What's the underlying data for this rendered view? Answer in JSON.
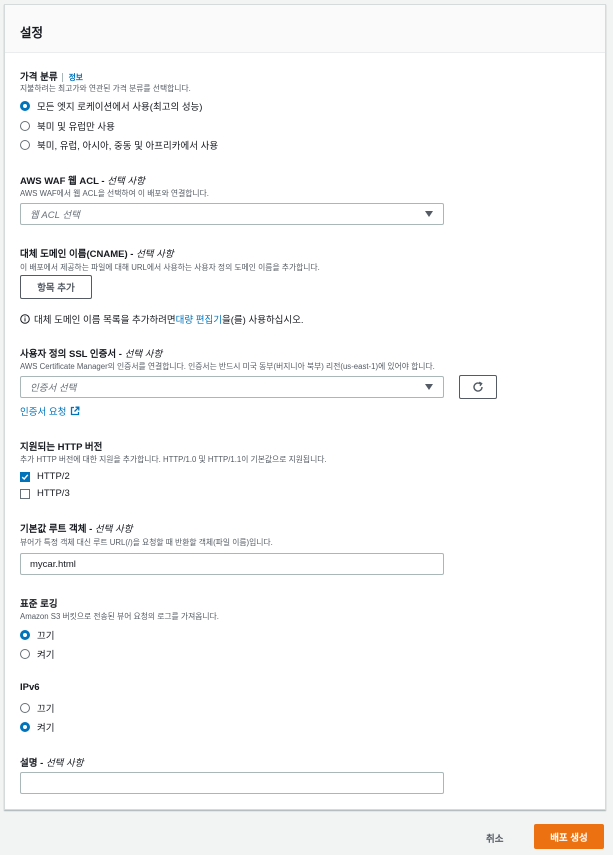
{
  "panel": {
    "title": "설정"
  },
  "price_class": {
    "label": "가격 분류",
    "info": "정보",
    "description": "지불하려는 최고가와 연관된 가격 분류를 선택합니다.",
    "options": [
      {
        "label": "모든 엣지 로케이션에서 사용(최고의 성능)",
        "selected": true
      },
      {
        "label": "북미 및 유럽만 사용",
        "selected": false
      },
      {
        "label": "북미, 유럽, 아시아, 중동 및 아프리카에서 사용",
        "selected": false
      }
    ]
  },
  "waf": {
    "label": "AWS WAF 웹 ACL - ",
    "optional": "선택 사항",
    "description": "AWS WAF에서 웹 ACL을 선택하여 이 배포와 연결합니다.",
    "placeholder": "웹 ACL 선택"
  },
  "cname": {
    "label": "대체 도메인 이름(CNAME) - ",
    "optional": "선택 사항",
    "description": "이 배포에서 제공하는 파일에 대해 URL에서 사용하는 사용자 정의 도메인 이름을 추가합니다.",
    "add_button": "항목 추가",
    "hint_before": "대체 도메인 이름 목록을 추가하려면 ",
    "hint_link": "대량 편집기",
    "hint_after": "을(를) 사용하십시오."
  },
  "ssl": {
    "label": "사용자 정의 SSL 인증서 - ",
    "optional": "선택 사항",
    "description": "AWS Certificate Manager의 인증서를 연결합니다. 인증서는 반드시 미국 동부(버지니아 북부) 리전(us-east-1)에 있어야 합니다.",
    "placeholder": "인증서 선택",
    "request_link": "인증서 요청"
  },
  "http": {
    "label": "지원되는 HTTP 버전",
    "description": "추가 HTTP 버전에 대한 지원을 추가합니다. HTTP/1.0 및 HTTP/1.1이 기본값으로 지원됩니다.",
    "options": [
      {
        "label": "HTTP/2",
        "checked": true
      },
      {
        "label": "HTTP/3",
        "checked": false
      }
    ]
  },
  "root": {
    "label": "기본값 루트 객체 - ",
    "optional": "선택 사항",
    "description": "뷰어가 특정 객체 대신 루트 URL(/)을 요청할 때 반환할 객체(파일 이름)입니다.",
    "value": "mycar.html"
  },
  "logging": {
    "label": "표준 로깅",
    "description": "Amazon S3 버킷으로 전송된 뷰어 요청의 로그를 가져옵니다.",
    "options": [
      {
        "label": "끄기",
        "selected": true
      },
      {
        "label": "켜기",
        "selected": false
      }
    ]
  },
  "ipv6": {
    "label": "IPv6",
    "options": [
      {
        "label": "끄기",
        "selected": false
      },
      {
        "label": "켜기",
        "selected": true
      }
    ]
  },
  "comment": {
    "label": "설명 - ",
    "optional": "선택 사항",
    "value": ""
  },
  "footer": {
    "cancel": "취소",
    "create": "배포 생성"
  },
  "colors": {
    "accent": "#0073bb",
    "primary_button": "#ec7211"
  }
}
